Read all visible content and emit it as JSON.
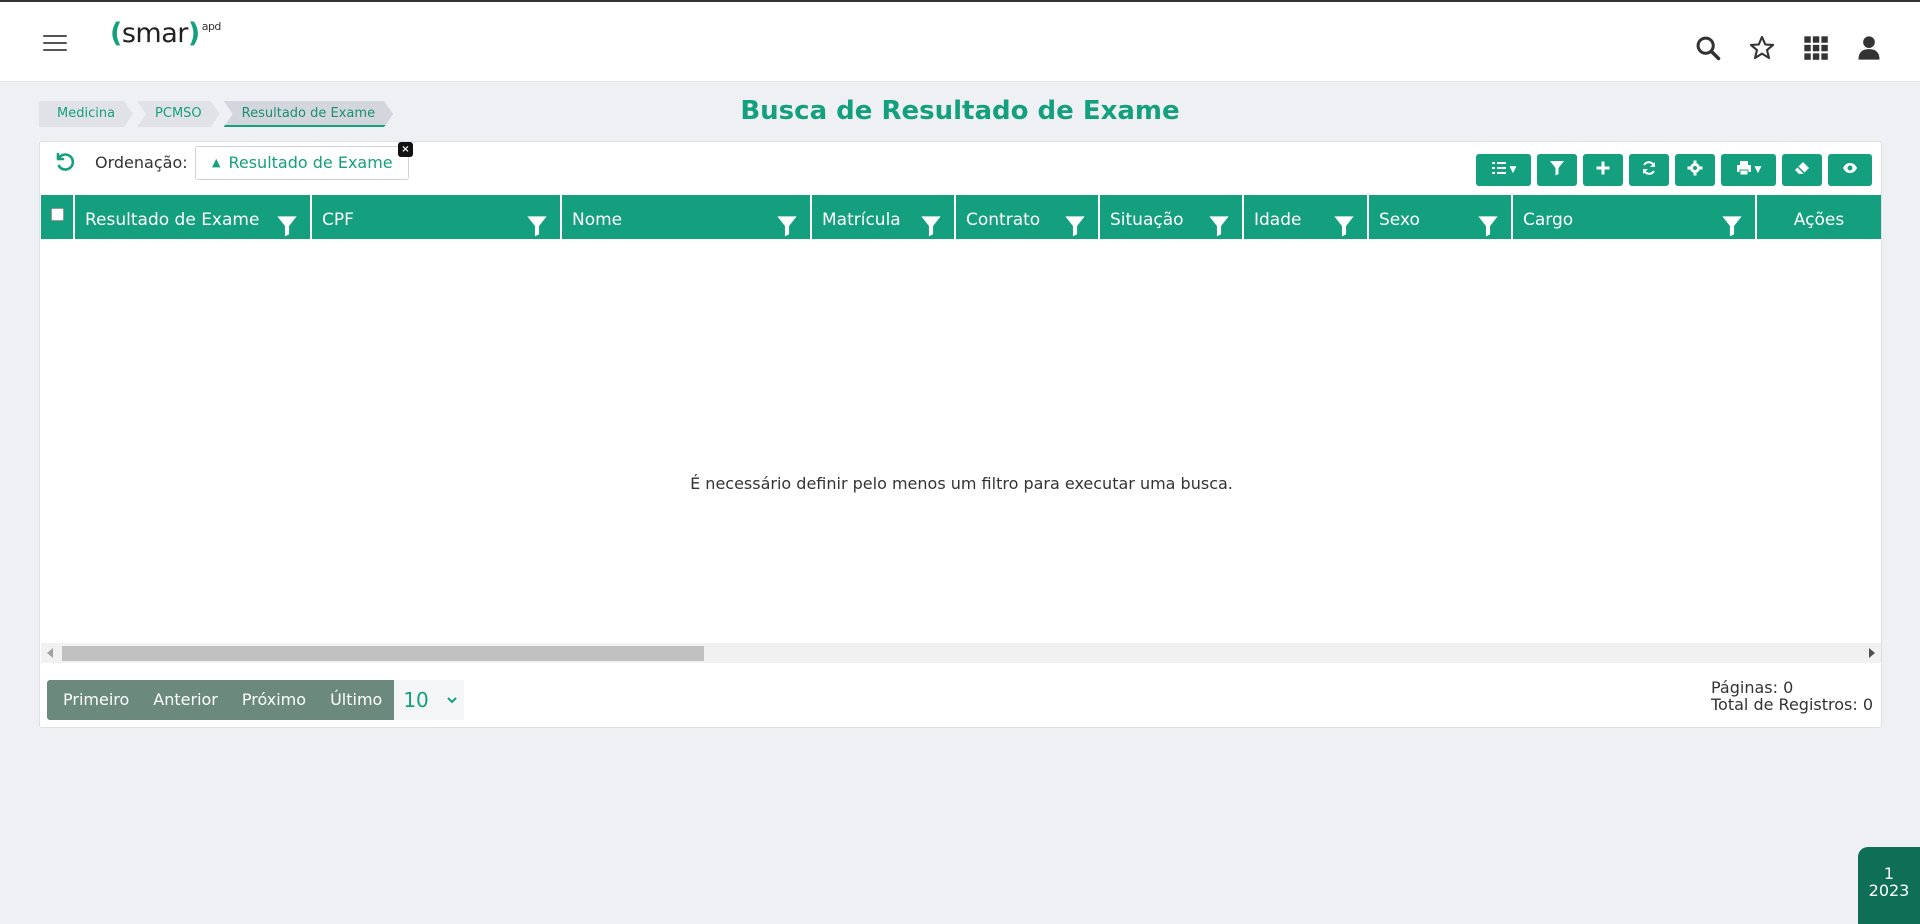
{
  "header": {
    "logo_text": "smar",
    "logo_open": "(",
    "logo_close": ")",
    "logo_sup": "apd",
    "icons": [
      "menu-icon",
      "search-icon",
      "star-icon",
      "apps-grid-icon",
      "user-icon"
    ]
  },
  "breadcrumb": [
    "Medicina",
    "PCMSO",
    "Resultado de Exame"
  ],
  "page_title": "Busca de Resultado de Exame",
  "ordering": {
    "label": "Ordenação:",
    "chip": "Resultado de Exame",
    "close": "×"
  },
  "toolbar": [
    "columns-list-icon",
    "filter-icon",
    "add-icon",
    "refresh-icon",
    "settings-icon",
    "print-icon",
    "eraser-icon",
    "eye-icon"
  ],
  "table": {
    "columns": [
      "Resultado de Exame",
      "CPF",
      "Nome",
      "Matrícula",
      "Contrato",
      "Situação",
      "Idade",
      "Sexo",
      "Cargo",
      "Ações"
    ],
    "empty_message": "É necessário definir pelo menos um filtro para executar uma busca."
  },
  "pager": {
    "first": "Primeiro",
    "prev": "Anterior",
    "next": "Próximo",
    "last": "Último",
    "page_size": "10",
    "pages": "Páginas: 0",
    "total": "Total de Registros: 0"
  },
  "period_badge": {
    "month": "1",
    "year": "2023"
  },
  "colors": {
    "accent": "#14a07e",
    "pager_button": "#6b8a7d",
    "badge": "#0f6e56"
  }
}
